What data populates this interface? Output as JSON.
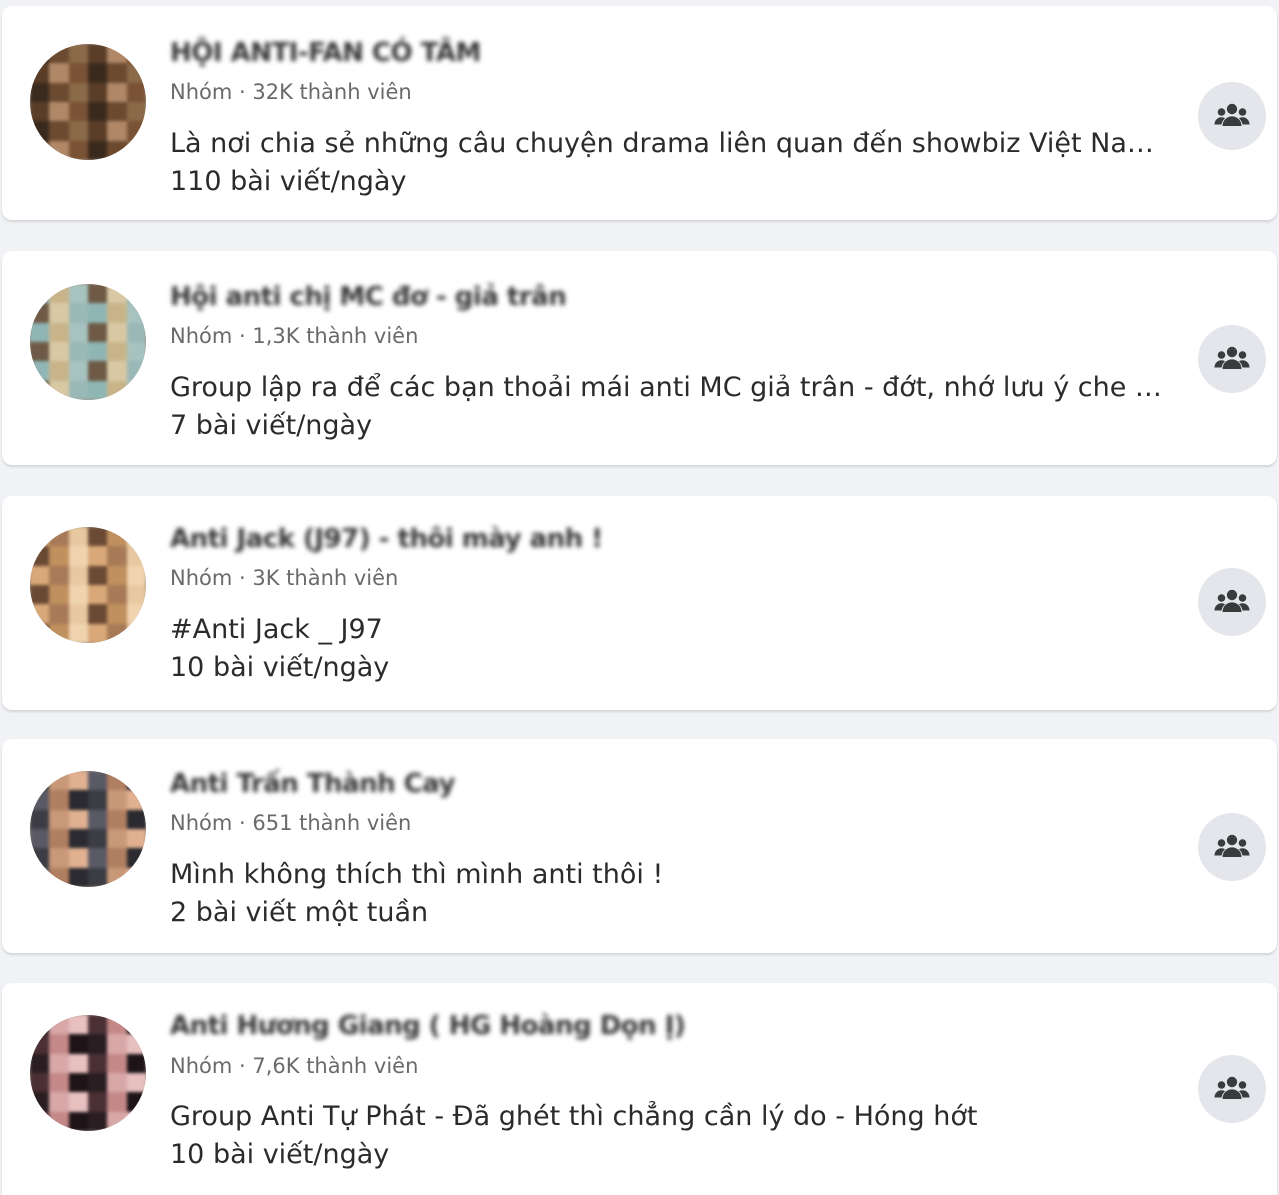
{
  "groups": [
    {
      "name": "HỘI ANTI-FAN CÓ TÂM",
      "meta": "Nhóm · 32K thành viên",
      "description": "Là nơi chia sẻ những câu chuyện drama liên quan đến showbiz Việt Nam và q...",
      "activity": "110 bài viết/ngày",
      "avatar_colors": [
        "#3a2a1e",
        "#6b4a30",
        "#8a6a48",
        "#5a3e28",
        "#b08868",
        "#7a5236"
      ]
    },
    {
      "name": "Hội anti chị MC đơ - giả trân",
      "meta": "Nhóm · 1,3K thành viên",
      "description": "Group lập ra để các bạn thoải mái anti MC giả trân - đớt, nhớ lưu ý che hình ả...",
      "activity": "7 bài viết/ngày",
      "avatar_colors": [
        "#8fb6b4",
        "#c9b48a",
        "#a7c3c0",
        "#6e5a46",
        "#d8c9a4",
        "#9ab8b6"
      ]
    },
    {
      "name": "Anti Jack (J97) - thôi mày anh !",
      "meta": "Nhóm · 3K thành viên",
      "description": "#Anti Jack _ J97",
      "activity": "10 bài viết/ngày",
      "avatar_colors": [
        "#d8a878",
        "#a87a58",
        "#e8c8a0",
        "#6a4a34",
        "#c0905e",
        "#f0d4b0"
      ]
    },
    {
      "name": "Anti Trấn Thành Cay",
      "meta": "Nhóm · 651 thành viên",
      "description": "Mình không thích thì mình anti thôi !",
      "activity": "2 bài viết một tuần",
      "avatar_colors": [
        "#3c3c44",
        "#c89878",
        "#e0b090",
        "#5a5a66",
        "#b07e60",
        "#2a2a30"
      ]
    },
    {
      "name": "Anti Hương Giang ( HG Hoàng Dọn Ị)",
      "meta": "Nhóm · 7,6K thành viên",
      "description": "Group Anti Tự Phát - Đã ghét thì chẳng cần lý do - Hóng hớt",
      "activity": "10 bài viết/ngày",
      "avatar_colors": [
        "#2a1e22",
        "#d8a8a8",
        "#e8c0c0",
        "#4a3034",
        "#c48888",
        "#1e1418"
      ]
    }
  ],
  "icons": {
    "join": "group-icon"
  }
}
